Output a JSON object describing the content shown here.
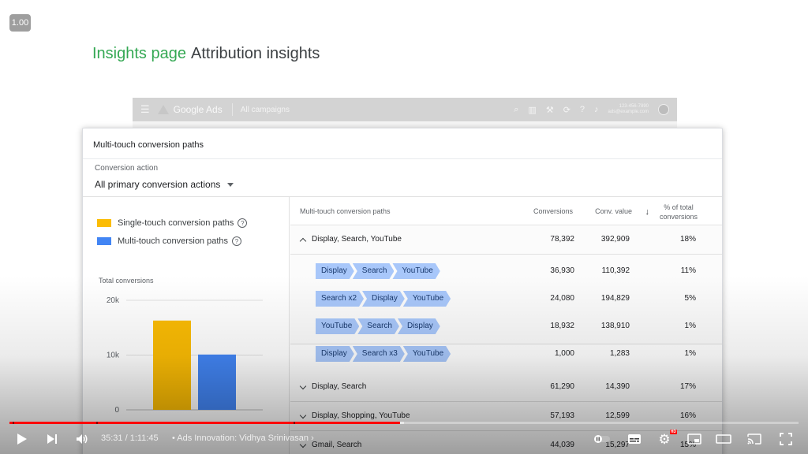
{
  "speed": "1.00",
  "slide": {
    "title_accent": "Insights page",
    "title_rest": "Attribution insights"
  },
  "ads_bar": {
    "brand": "Google Ads",
    "breadcrumb": "All campaigns",
    "tools": [
      "search-icon",
      "reports-icon",
      "tools-icon",
      "refresh-icon",
      "help-icon",
      "notifications-icon"
    ],
    "account_line1": "123-456-7890",
    "account_line2": "ads@example.com"
  },
  "card": {
    "title": "Multi-touch conversion paths",
    "conversion_action_label": "Conversion action",
    "conversion_action_value": "All primary conversion actions"
  },
  "legend": [
    {
      "label": "Single-touch conversion paths",
      "color": "#fbbc04"
    },
    {
      "label": "Multi-touch conversion paths",
      "color": "#4285f4"
    }
  ],
  "chart_data": {
    "type": "bar",
    "title": "Total conversions",
    "categories": [
      "Single-touch conversion paths",
      "Multi-touch conversion paths"
    ],
    "values": [
      16300,
      10100
    ],
    "colors": [
      "#fbbc04",
      "#4285f4"
    ],
    "yticks": [
      "20k",
      "10k",
      "0"
    ],
    "ylim": [
      0,
      20000
    ],
    "grid": true
  },
  "table": {
    "headers": {
      "path": "Multi-touch conversion paths",
      "conversions": "Conversions",
      "conv_value": "Conv. value",
      "pct_line1": "% of total",
      "pct_line2": "conversions"
    },
    "groups": [
      {
        "label": "Display, Search, YouTube",
        "conversions": "78,392",
        "value": "392,909",
        "pct": "18%",
        "expanded": true,
        "subrows": [
          {
            "chips": [
              "Display",
              "Search",
              "YouTube"
            ],
            "conversions": "36,930",
            "value": "110,392",
            "pct": "11%"
          },
          {
            "chips": [
              "Search x2",
              "Display",
              "YouTube"
            ],
            "conversions": "24,080",
            "value": "194,829",
            "pct": "5%"
          },
          {
            "chips": [
              "YouTube",
              "Search",
              "Display"
            ],
            "conversions": "18,932",
            "value": "138,910",
            "pct": "1%"
          },
          {
            "chips": [
              "Display",
              "Search x3",
              "YouTube"
            ],
            "conversions": "1,000",
            "value": "1,283",
            "pct": "1%"
          }
        ]
      },
      {
        "label": "Display, Search",
        "conversions": "61,290",
        "value": "14,390",
        "pct": "17%",
        "expanded": false
      },
      {
        "label": "Display, Shopping, YouTube",
        "conversions": "57,193",
        "value": "12,599",
        "pct": "16%",
        "expanded": false
      },
      {
        "label": "Gmail, Search",
        "conversions": "44,039",
        "value": "15,297",
        "pct": "15%",
        "expanded": false
      }
    ]
  },
  "player": {
    "time": "35:31 / 1:11:45",
    "chapter": "• Ads Innovation: Vidhya Srinivasan",
    "played_fraction": 0.495,
    "loaded_fraction": 0.5,
    "hd": "HD"
  }
}
